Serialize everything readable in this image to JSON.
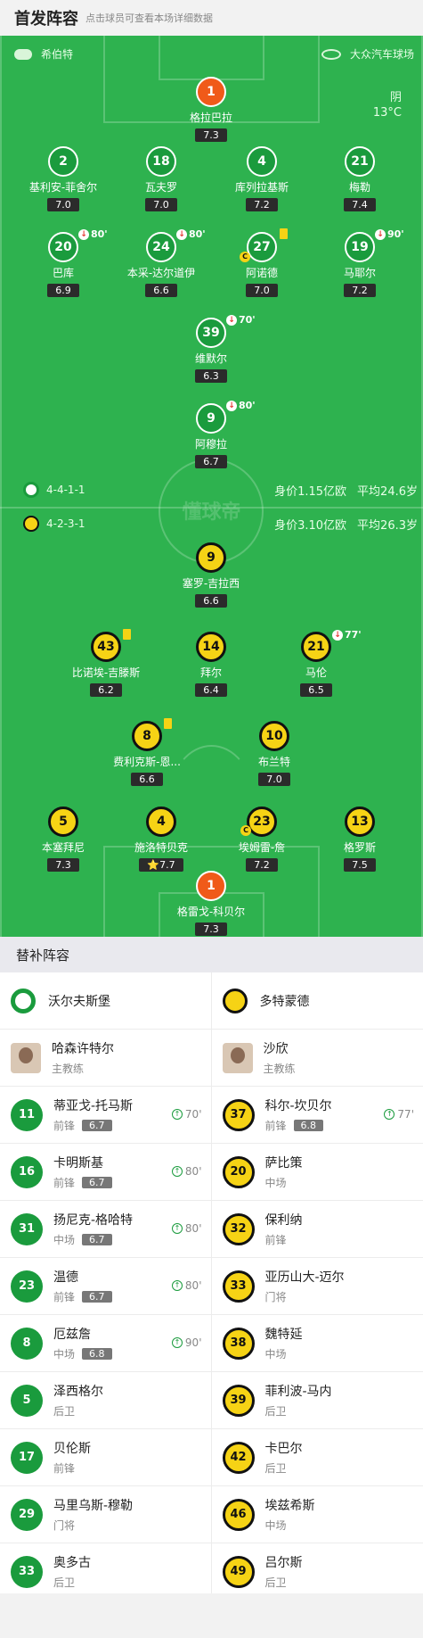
{
  "header": {
    "title": "首发阵容",
    "subtitle": "点击球员可查看本场详细数据"
  },
  "pitch": {
    "coach_home": "希伯特",
    "stadium": "大众汽车球场",
    "weather": "阴",
    "temp": "13°C",
    "watermark": "懂球帝",
    "home_formation": "4-4-1-1",
    "home_value": "身价1.15亿欧",
    "home_age": "平均24.6岁",
    "away_formation": "4-2-3-1",
    "away_value": "身价3.10亿欧",
    "away_age": "平均26.3岁",
    "home_players": [
      {
        "num": "1",
        "name": "格拉巴拉",
        "rating": "7.3"
      },
      {
        "num": "2",
        "name": "基利安-菲舍尔",
        "rating": "7.0"
      },
      {
        "num": "18",
        "name": "瓦夫罗",
        "rating": "7.0"
      },
      {
        "num": "4",
        "name": "库列拉基斯",
        "rating": "7.2"
      },
      {
        "num": "21",
        "name": "梅勒",
        "rating": "7.4"
      },
      {
        "num": "20",
        "name": "巴库",
        "rating": "6.9",
        "sub": "80'"
      },
      {
        "num": "24",
        "name": "本采-达尔道伊",
        "rating": "6.6",
        "sub": "80'"
      },
      {
        "num": "27",
        "name": "阿诺德",
        "rating": "7.0",
        "cap": "C"
      },
      {
        "num": "19",
        "name": "马耶尔",
        "rating": "7.2",
        "sub": "90'"
      },
      {
        "num": "39",
        "name": "维默尔",
        "rating": "6.3",
        "sub": "70'"
      },
      {
        "num": "9",
        "name": "阿穆拉",
        "rating": "6.7",
        "sub": "80'"
      }
    ],
    "away_players": [
      {
        "num": "9",
        "name": "塞罗-吉拉西",
        "rating": "6.6"
      },
      {
        "num": "43",
        "name": "比诺埃-吉滕斯",
        "rating": "6.2"
      },
      {
        "num": "14",
        "name": "拜尔",
        "rating": "6.4"
      },
      {
        "num": "21",
        "name": "马伦",
        "rating": "6.5",
        "sub": "77'"
      },
      {
        "num": "8",
        "name": "费利克斯-恩...",
        "rating": "6.6"
      },
      {
        "num": "10",
        "name": "布兰特",
        "rating": "7.0"
      },
      {
        "num": "5",
        "name": "本塞拜尼",
        "rating": "7.3"
      },
      {
        "num": "4",
        "name": "施洛特贝克",
        "rating": "7.7",
        "star": "⭐"
      },
      {
        "num": "23",
        "name": "埃姆雷-詹",
        "rating": "7.2",
        "cap": "C"
      },
      {
        "num": "13",
        "name": "格罗斯",
        "rating": "7.5"
      },
      {
        "num": "1",
        "name": "格雷戈-科贝尔",
        "rating": "7.3"
      }
    ]
  },
  "subs": {
    "title": "替补阵容",
    "home_team": "沃尔夫斯堡",
    "away_team": "多特蒙德",
    "home_coach": {
      "name": "哈森许特尔",
      "role": "主教练"
    },
    "away_coach": {
      "name": "沙欣",
      "role": "主教练"
    },
    "rows": [
      [
        {
          "num": "11",
          "name": "蒂亚戈-托马斯",
          "pos": "前锋",
          "rating": "6.7",
          "min": "70'"
        },
        {
          "num": "37",
          "name": "科尔-坎贝尔",
          "pos": "前锋",
          "rating": "6.8",
          "min": "77'"
        }
      ],
      [
        {
          "num": "16",
          "name": "卡明斯基",
          "pos": "前锋",
          "rating": "6.7",
          "min": "80'"
        },
        {
          "num": "20",
          "name": "萨比策",
          "pos": "中场"
        }
      ],
      [
        {
          "num": "31",
          "name": "扬尼克-格哈特",
          "pos": "中场",
          "rating": "6.7",
          "min": "80'"
        },
        {
          "num": "32",
          "name": "保利纳",
          "pos": "前锋"
        }
      ],
      [
        {
          "num": "23",
          "name": "温德",
          "pos": "前锋",
          "rating": "6.7",
          "min": "80'"
        },
        {
          "num": "33",
          "name": "亚历山大-迈尔",
          "pos": "门将"
        }
      ],
      [
        {
          "num": "8",
          "name": "厄兹詹",
          "pos": "中场",
          "rating": "6.8",
          "min": "90'"
        },
        {
          "num": "38",
          "name": "魏特延",
          "pos": "中场"
        }
      ],
      [
        {
          "num": "5",
          "name": "泽西格尔",
          "pos": "后卫"
        },
        {
          "num": "39",
          "name": "菲利波-马内",
          "pos": "后卫"
        }
      ],
      [
        {
          "num": "17",
          "name": "贝伦斯",
          "pos": "前锋"
        },
        {
          "num": "42",
          "name": "卡巴尔",
          "pos": "后卫"
        }
      ],
      [
        {
          "num": "29",
          "name": "马里乌斯-穆勒",
          "pos": "门将"
        },
        {
          "num": "46",
          "name": "埃兹希斯",
          "pos": "中场"
        }
      ],
      [
        {
          "num": "33",
          "name": "奥多古",
          "pos": "后卫"
        },
        {
          "num": "49",
          "name": "吕尔斯",
          "pos": "后卫"
        }
      ]
    ]
  },
  "colors": {
    "pitch": "#2eb24f",
    "home": "#1a9b3d",
    "away": "#f6d315",
    "gk": "#f05a19"
  }
}
